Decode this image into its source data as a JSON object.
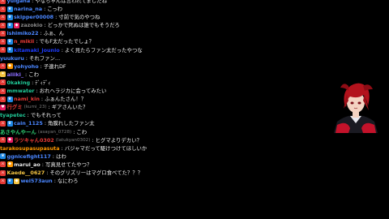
{
  "chat": {
    "messages": [
      {
        "user": "yuigana",
        "sub": "",
        "text": "やなちゃんは言われてましたね",
        "color": "#4a86ff",
        "badges": [
          {
            "icon": "sword-icon",
            "color": "#e53935",
            "glyph": "⚔"
          }
        ]
      },
      {
        "user": "narina_na",
        "sub": "",
        "text": "こっわ",
        "color": "#4a86ff",
        "badges": [
          {
            "icon": "sword-icon",
            "color": "#e53935",
            "glyph": "⚔"
          },
          {
            "icon": "prime-crown-icon",
            "color": "#1e88e5",
            "glyph": "♛"
          }
        ]
      },
      {
        "user": "skipper00008",
        "sub": "",
        "text": "寸前で気のやつね",
        "color": "#4a86ff",
        "badges": [
          {
            "icon": "sword-icon",
            "color": "#e53935",
            "glyph": "⚔"
          },
          {
            "icon": "prime-crown-icon",
            "color": "#1e88e5",
            "glyph": "♛"
          }
        ]
      },
      {
        "user": "zazokio",
        "sub": "",
        "text": "どっかで死ぬは誰でもそうだろ",
        "color": "#8a8a8a",
        "badges": [
          {
            "icon": "sword-icon",
            "color": "#e53935",
            "glyph": "⚔"
          },
          {
            "icon": "prime-crown-icon",
            "color": "#1e88e5",
            "glyph": "♛"
          },
          {
            "icon": "bits-badge-icon",
            "color": "#e91e63",
            "glyph": "◆"
          }
        ]
      },
      {
        "user": "ishimiko22",
        "sub": "",
        "text": "ふぁ、ん",
        "color": "#4a86ff",
        "badges": [
          {
            "icon": "sword-icon",
            "color": "#e53935",
            "glyph": "⚔"
          }
        ]
      },
      {
        "user": "n_mikii",
        "sub": "",
        "text": "でもF太だったでしょ？",
        "color": "#e53935",
        "badges": [
          {
            "icon": "sword-icon",
            "color": "#e53935",
            "glyph": "⚔"
          },
          {
            "icon": "prime-crown-icon",
            "color": "#1e88e5",
            "glyph": "♛"
          }
        ]
      },
      {
        "user": "kitamaki_jounio",
        "sub": "",
        "text": "よく見たらファン太だったやつな",
        "color": "#1e3cff",
        "badges": [
          {
            "icon": "sword-icon",
            "color": "#e53935",
            "glyph": "⚔"
          },
          {
            "icon": "prime-crown-icon",
            "color": "#1e88e5",
            "glyph": "♛"
          }
        ]
      },
      {
        "user": "yuukuru",
        "sub": "",
        "text": "それファン…",
        "color": "#4a86ff",
        "badges": []
      },
      {
        "user": "yohyoho",
        "sub": "",
        "text": "子連れDF",
        "color": "#4a86ff",
        "badges": [
          {
            "icon": "sword-icon",
            "color": "#e53935",
            "glyph": "⚔"
          },
          {
            "icon": "bits-badge-icon",
            "color": "#ff9800",
            "glyph": "◆"
          }
        ]
      },
      {
        "user": "aliiki_",
        "sub": "",
        "text": "こわ",
        "color": "#8a6cff",
        "badges": [
          {
            "icon": "hype-badge-icon",
            "color": "#f5c542",
            "glyph": "✦"
          }
        ]
      },
      {
        "user": "0kaking",
        "sub": "",
        "text": "ﾃﾞｨﾃﾞｨ",
        "color": "#20c997",
        "badges": [
          {
            "icon": "sword-icon",
            "color": "#e53935",
            "glyph": "⚔"
          }
        ]
      },
      {
        "user": "mmwater",
        "sub": "",
        "text": "おれヘラジカに会ってみたい",
        "color": "#20c997",
        "badges": [
          {
            "icon": "sword-icon",
            "color": "#e53935",
            "glyph": "⚔"
          }
        ]
      },
      {
        "user": "nami_kin",
        "sub": "",
        "text": "ふぁんたさん！？",
        "color": "#e53935",
        "badges": [
          {
            "icon": "sword-icon",
            "color": "#e53935",
            "glyph": "⚔"
          },
          {
            "icon": "prime-crown-icon",
            "color": "#1e88e5",
            "glyph": "♛"
          }
        ]
      },
      {
        "user": "行グミ",
        "sub": "(kumi_23)",
        "text": "ギアさんいた？",
        "color": "#e53935",
        "badges": [
          {
            "icon": "heart-icon",
            "color": "#e91e63",
            "glyph": "♥"
          }
        ]
      },
      {
        "user": "tyapetec",
        "sub": "",
        "text": "でもそれって",
        "color": "#20c997",
        "badges": []
      },
      {
        "user": "cain_1125",
        "sub": "",
        "text": "角膜れしたファン太",
        "color": "#4a86ff",
        "badges": [
          {
            "icon": "sword-icon",
            "color": "#e53935",
            "glyph": "⚔"
          },
          {
            "icon": "prime-crown-icon",
            "color": "#1e88e5",
            "glyph": "♛"
          }
        ]
      },
      {
        "user": "あさやんやーん",
        "sub": "(asayan_0728)",
        "text": "こわ",
        "color": "#2ecc71",
        "badges": []
      },
      {
        "user": "ラツキャん0302",
        "sub": "(latukyan0302)",
        "text": "ヒグマよりデカい？",
        "color": "#e53935",
        "badges": [
          {
            "icon": "sword-icon",
            "color": "#e53935",
            "glyph": "⚔"
          },
          {
            "icon": "bits-badge-icon",
            "color": "#e91e63",
            "glyph": "◆"
          }
        ]
      },
      {
        "user": "tarakosupasupasuta",
        "sub": "",
        "text": "バジャマだって駆けつけてほしいか",
        "color": "#ff9800",
        "badges": []
      },
      {
        "user": "ggnicefight117",
        "sub": "",
        "text": "はわ",
        "color": "#4a86ff",
        "badges": [
          {
            "icon": "prime-crown-icon",
            "color": "#1e88e5",
            "glyph": "♛"
          }
        ]
      },
      {
        "user": "marui_ao",
        "sub": "",
        "text": "写真見せてたやつ？",
        "color": "#e8e8e8",
        "badges": [
          {
            "icon": "sword-icon",
            "color": "#e53935",
            "glyph": "⚔"
          },
          {
            "icon": "bits-badge-icon",
            "color": "#ff9800",
            "glyph": "◆"
          }
        ]
      },
      {
        "user": "Kaede__0627",
        "sub": "",
        "text": "そのグリズリーはマグロ食べてた？？？",
        "color": "#f5c542",
        "badges": [
          {
            "icon": "sword-icon",
            "color": "#e53935",
            "glyph": "⚔"
          }
        ]
      },
      {
        "user": "wei573aun",
        "sub": "",
        "text": "なにわろ",
        "color": "#4a86ff",
        "badges": [
          {
            "icon": "sword-icon",
            "color": "#e53935",
            "glyph": "⚔"
          },
          {
            "icon": "prime-crown-icon",
            "color": "#1e88e5",
            "glyph": "♛"
          },
          {
            "icon": "bits-badge-icon",
            "color": "#f5c542",
            "glyph": "◆"
          }
        ]
      }
    ]
  },
  "avatar": {
    "icon": "vtuber-avatar-icon",
    "hair_color": "#b3121c",
    "skin_color": "#f3d2c1",
    "outfit_color": "#1a1a22",
    "accent_color": "#c3122a"
  }
}
